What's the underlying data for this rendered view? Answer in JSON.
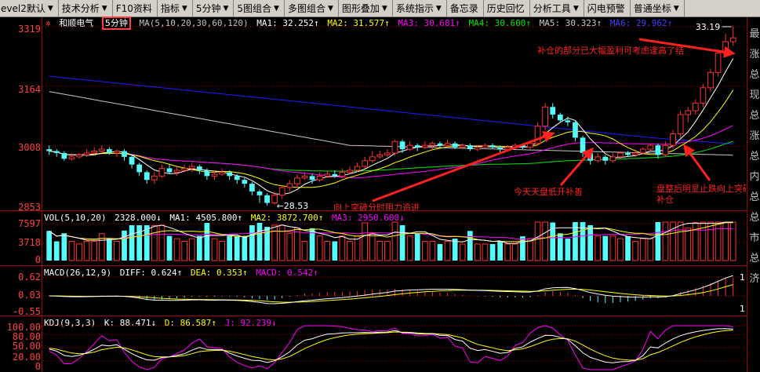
{
  "menu": {
    "items": [
      {
        "label": "evel2默认",
        "arrow": "▼"
      },
      {
        "label": "技术分析",
        "arrow": "▼"
      },
      {
        "label": "F10资料",
        "arrow": ""
      },
      {
        "label": "指标",
        "arrow": "▼"
      },
      {
        "label": "5分钟",
        "arrow": "▼"
      },
      {
        "label": "5图组合",
        "arrow": "▼"
      },
      {
        "label": "多图组合",
        "arrow": "▼"
      },
      {
        "label": "图形叠加",
        "arrow": "▼"
      },
      {
        "label": "系统指示",
        "arrow": "▼"
      },
      {
        "label": "备忘录",
        "arrow": ""
      },
      {
        "label": "历史回忆",
        "arrow": ""
      },
      {
        "label": "分析工具",
        "arrow": "▼"
      },
      {
        "label": "闪电预警",
        "arrow": ""
      },
      {
        "label": "普通坐标",
        "arrow": "▼"
      }
    ]
  },
  "colors": {
    "up": "#ff3232",
    "down": "#54fcfc",
    "ma1": "#ffffff",
    "ma2": "#ffff00",
    "ma3": "#ff00ff",
    "ma4": "#00e600",
    "ma5": "#c8c8c8",
    "ma6": "#1e1eff",
    "annotation": "#ff2020",
    "axis": "#ff4040",
    "highlight_box": "#ff4040"
  },
  "price_panel": {
    "stock_name": "和顺电气",
    "period": "5分钟",
    "ma_label": "MA(5,10,20,30,60,120)",
    "ma1": "MA1: 32.252↑",
    "ma2": "MA2: 31.577↑",
    "ma3": "MA3: 30.681↑",
    "ma4": "MA4: 30.600↑",
    "ma5": "MA5: 30.323↑",
    "ma6": "MA6: 29.962↑",
    "y_labels": [
      "3319",
      "3164",
      "3008",
      "2853"
    ],
    "high_label": "33.19",
    "low_label": "28.53",
    "annotations": [
      "补仓的部分已大幅盈利可考虑逢高了结",
      "向上突破分时阻力追进",
      "今天天盘低开补善",
      "盘整后明显止跌向上突破",
      "补仓"
    ]
  },
  "vol_panel": {
    "label": "VOL(5,10,20)",
    "value": "2328.000↓",
    "ma1": "MA1: 4505.800↑",
    "ma2": "MA2: 3872.700↑",
    "ma3": "MA3: 2950.600↓",
    "y_labels": [
      "7597",
      "3718",
      "0"
    ]
  },
  "macd_panel": {
    "label": "MACD(26,12,9)",
    "diff": "DIFF: 0.624↑",
    "dea": "DEA: 0.353↑",
    "macd": "MACD: 0.542↑",
    "y_labels": [
      "0.62",
      "0.03",
      "-0.55"
    ],
    "right_labels": [
      "1",
      "1"
    ]
  },
  "kdj_panel": {
    "label": "KDJ(9,3,3)",
    "k": "K: 88.471↓",
    "d": "D: 86.587↑",
    "j": "J: 92.239↓",
    "y_labels": [
      "100.00",
      "80.00",
      "50.00",
      "20.00",
      "0"
    ]
  },
  "right_strip": {
    "chars": [
      "最",
      "涨",
      "总",
      "现",
      "总",
      "涨",
      "总",
      "内",
      "总",
      "总",
      "市",
      "总",
      "济"
    ]
  },
  "chart_data": {
    "type": "candlestick",
    "title": "",
    "ylim": [
      28.53,
      33.19
    ],
    "candles": [
      [
        30.0,
        29.95,
        30.1,
        29.85
      ],
      [
        29.95,
        29.9,
        30.0,
        29.8
      ],
      [
        29.9,
        29.75,
        29.95,
        29.7
      ],
      [
        29.75,
        29.8,
        29.9,
        29.7
      ],
      [
        29.8,
        29.85,
        29.9,
        29.75
      ],
      [
        29.85,
        29.9,
        30.0,
        29.8
      ],
      [
        29.9,
        29.95,
        30.05,
        29.85
      ],
      [
        29.95,
        30.0,
        30.1,
        29.9
      ],
      [
        30.0,
        29.9,
        30.05,
        29.85
      ],
      [
        29.9,
        29.95,
        30.0,
        29.8
      ],
      [
        29.95,
        29.8,
        30.0,
        29.7
      ],
      [
        29.8,
        29.6,
        29.85,
        29.5
      ],
      [
        29.6,
        29.4,
        29.65,
        29.3
      ],
      [
        29.4,
        29.2,
        29.45,
        29.1
      ],
      [
        29.2,
        29.3,
        29.4,
        29.1
      ],
      [
        29.3,
        29.5,
        29.6,
        29.25
      ],
      [
        29.5,
        29.4,
        29.6,
        29.35
      ],
      [
        29.4,
        29.45,
        29.55,
        29.3
      ],
      [
        29.45,
        29.5,
        29.6,
        29.4
      ],
      [
        29.5,
        29.55,
        29.65,
        29.4
      ],
      [
        29.55,
        29.45,
        29.6,
        29.35
      ],
      [
        29.45,
        29.3,
        29.5,
        29.2
      ],
      [
        29.3,
        29.35,
        29.45,
        29.2
      ],
      [
        29.35,
        29.4,
        29.5,
        29.3
      ],
      [
        29.4,
        29.3,
        29.45,
        29.2
      ],
      [
        29.3,
        29.2,
        29.35,
        29.1
      ],
      [
        29.2,
        29.1,
        29.25,
        29.0
      ],
      [
        29.1,
        28.9,
        29.15,
        28.8
      ],
      [
        28.9,
        28.8,
        28.95,
        28.6
      ],
      [
        28.8,
        28.6,
        28.85,
        28.53
      ],
      [
        28.6,
        28.8,
        28.9,
        28.55
      ],
      [
        28.8,
        29.0,
        29.05,
        28.7
      ],
      [
        29.0,
        29.1,
        29.2,
        28.9
      ],
      [
        29.1,
        29.25,
        29.35,
        29.0
      ],
      [
        29.25,
        29.3,
        29.4,
        29.2
      ],
      [
        29.3,
        29.2,
        29.35,
        29.1
      ],
      [
        29.2,
        29.3,
        29.4,
        29.15
      ],
      [
        29.3,
        29.35,
        29.45,
        29.25
      ],
      [
        29.35,
        29.3,
        29.45,
        29.25
      ],
      [
        29.3,
        29.4,
        29.5,
        29.25
      ],
      [
        29.4,
        29.45,
        29.55,
        29.35
      ],
      [
        29.45,
        29.55,
        29.65,
        29.4
      ],
      [
        29.55,
        29.7,
        29.8,
        29.5
      ],
      [
        29.7,
        29.8,
        29.95,
        29.65
      ],
      [
        29.8,
        29.85,
        29.95,
        29.75
      ],
      [
        29.85,
        29.9,
        30.0,
        29.8
      ],
      [
        29.9,
        30.2,
        30.25,
        29.85
      ],
      [
        30.2,
        30.0,
        30.25,
        29.9
      ],
      [
        30.0,
        30.1,
        30.2,
        29.95
      ],
      [
        30.1,
        30.05,
        30.15,
        29.95
      ],
      [
        30.05,
        30.1,
        30.2,
        30.0
      ],
      [
        30.1,
        30.15,
        30.2,
        30.0
      ],
      [
        30.15,
        30.1,
        30.2,
        30.05
      ],
      [
        30.1,
        30.15,
        30.25,
        30.05
      ],
      [
        30.15,
        30.05,
        30.2,
        30.0
      ],
      [
        30.05,
        30.1,
        30.15,
        30.0
      ],
      [
        30.1,
        30.0,
        30.15,
        29.95
      ],
      [
        30.0,
        30.05,
        30.1,
        29.95
      ],
      [
        30.05,
        30.1,
        30.15,
        30.0
      ],
      [
        30.1,
        30.05,
        30.15,
        30.0
      ],
      [
        30.05,
        30.0,
        30.1,
        29.9
      ],
      [
        30.0,
        30.05,
        30.1,
        29.95
      ],
      [
        30.05,
        30.1,
        30.15,
        30.0
      ],
      [
        30.1,
        30.05,
        30.15,
        30.0
      ],
      [
        30.05,
        30.15,
        30.2,
        30.0
      ],
      [
        30.15,
        30.6,
        30.7,
        30.1
      ],
      [
        30.6,
        31.1,
        31.2,
        30.5
      ],
      [
        31.1,
        30.9,
        31.2,
        30.8
      ],
      [
        30.9,
        30.75,
        30.95,
        30.7
      ],
      [
        30.75,
        30.7,
        30.85,
        30.6
      ],
      [
        30.7,
        30.3,
        30.75,
        30.2
      ],
      [
        30.3,
        29.9,
        30.35,
        29.8
      ],
      [
        29.9,
        29.7,
        29.95,
        29.6
      ],
      [
        29.7,
        29.8,
        29.9,
        29.65
      ],
      [
        29.8,
        29.7,
        29.85,
        29.6
      ],
      [
        29.7,
        29.8,
        29.9,
        29.65
      ],
      [
        29.8,
        29.9,
        29.95,
        29.75
      ],
      [
        29.9,
        29.85,
        29.95,
        29.8
      ],
      [
        29.85,
        29.9,
        30.0,
        29.8
      ],
      [
        29.9,
        30.0,
        30.05,
        29.85
      ],
      [
        30.0,
        30.1,
        30.15,
        29.95
      ],
      [
        30.1,
        29.85,
        30.15,
        29.75
      ],
      [
        29.85,
        30.1,
        30.2,
        29.8
      ],
      [
        30.1,
        30.4,
        30.5,
        30.0
      ],
      [
        30.4,
        30.9,
        31.0,
        30.3
      ],
      [
        30.9,
        31.0,
        31.1,
        30.7
      ],
      [
        31.0,
        31.2,
        31.3,
        30.9
      ],
      [
        31.2,
        31.6,
        31.7,
        31.1
      ],
      [
        31.6,
        32.0,
        32.1,
        31.5
      ],
      [
        32.0,
        32.5,
        32.6,
        31.9
      ],
      [
        32.5,
        32.8,
        33.0,
        32.4
      ],
      [
        32.8,
        32.9,
        33.19,
        32.7
      ]
    ]
  }
}
